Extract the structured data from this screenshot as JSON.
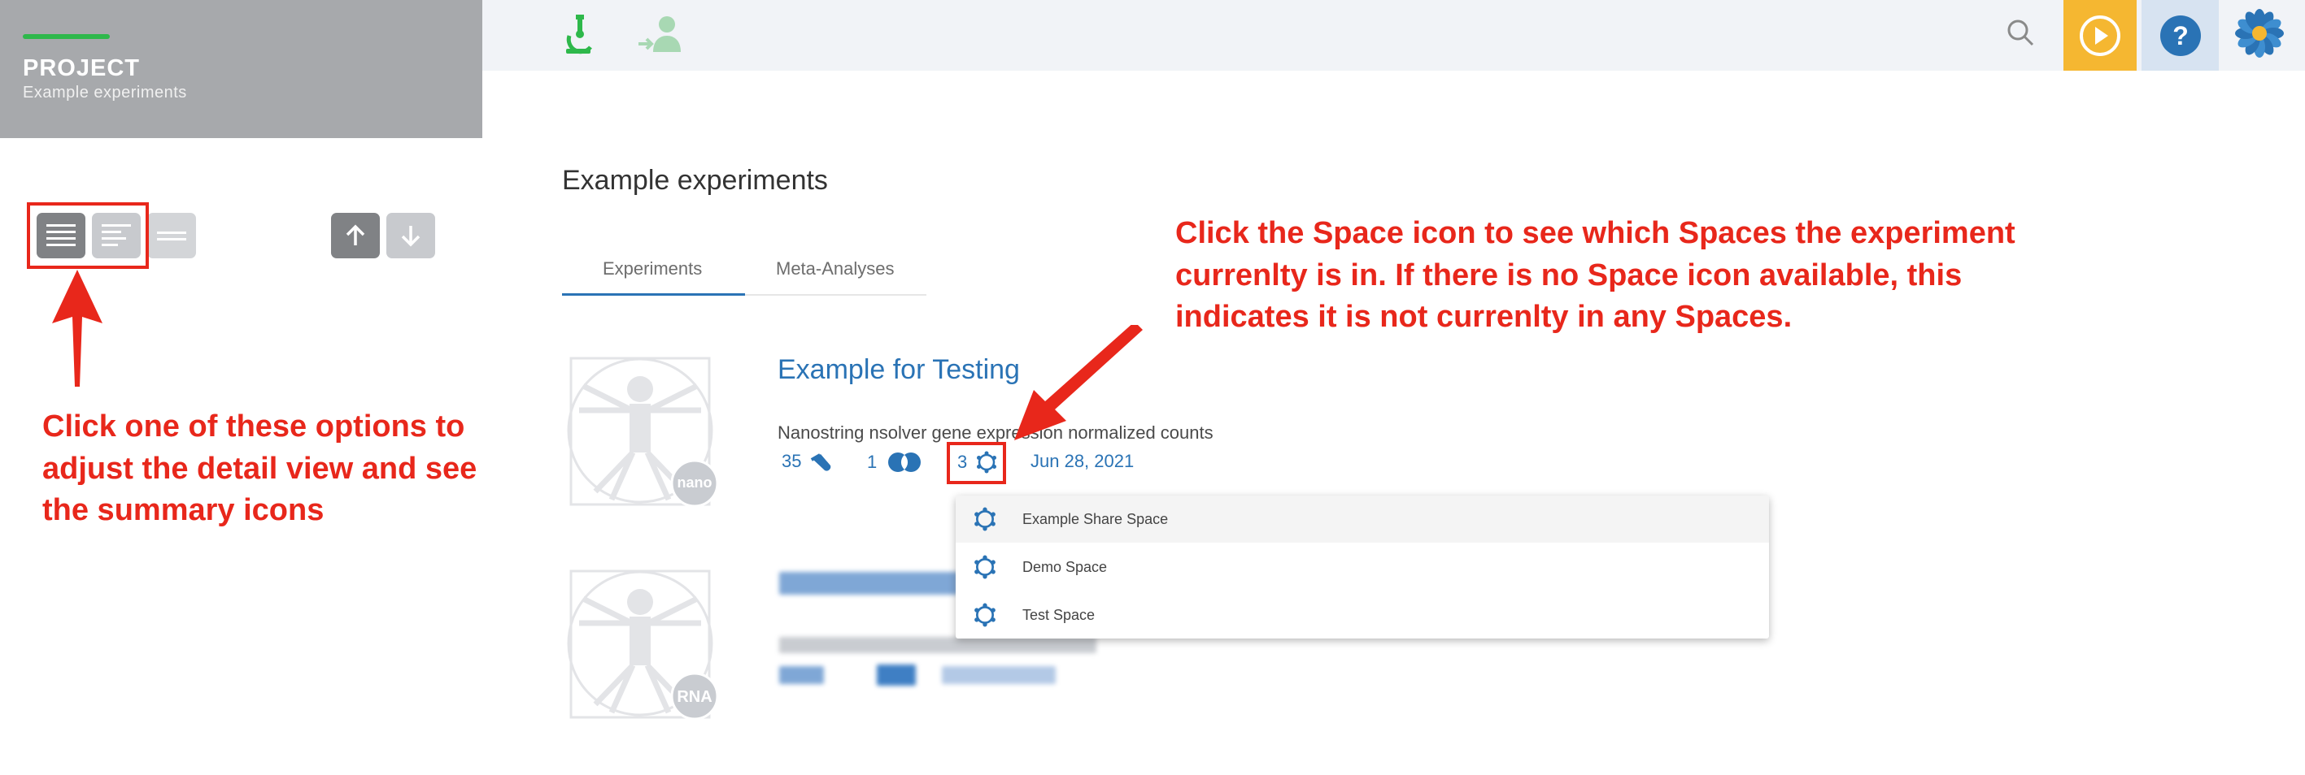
{
  "project": {
    "label": "PROJECT",
    "subtitle": "Example experiments"
  },
  "topbar": {
    "icons": [
      "microscope-icon",
      "add-user-icon",
      "search-icon",
      "play-icon",
      "help-icon",
      "flower-logo-icon"
    ],
    "play_color": "#f5b731",
    "help_bg": "#d7e3f1"
  },
  "main": {
    "title": "Example experiments",
    "tabs": [
      {
        "label": "Experiments",
        "active": true
      },
      {
        "label": "Meta-Analyses",
        "active": false
      }
    ],
    "experiments": [
      {
        "title": "Example for Testing",
        "description": "Nanostring nsolver gene expression normalized counts",
        "badge": "nano",
        "samples_count": "35",
        "datasets_count": "1",
        "spaces_count": "3",
        "date": "Jun 28, 2021"
      },
      {
        "badge": "RNA"
      }
    ]
  },
  "spaces_dropdown": {
    "items": [
      {
        "label": "Example Share Space",
        "hovered": true
      },
      {
        "label": "Demo Space",
        "hovered": false
      },
      {
        "label": "Test Space",
        "hovered": false
      }
    ]
  },
  "annotations": {
    "view_options": "Click one of these options to adjust the detail view and see the summary icons",
    "view_options_lines": [
      "Click one of these options to",
      "adjust the detail view and see",
      "the summary icons"
    ],
    "space_icon_lines": [
      "Click the Space icon to see which Spaces the experiment",
      "currenlty is in. If there is no Space icon available, this",
      "indicates it is not currenlty in any Spaces."
    ]
  },
  "colors": {
    "accent_blue": "#2a73b5",
    "annotation_red": "#e8271b",
    "project_green": "#2eb84b"
  }
}
